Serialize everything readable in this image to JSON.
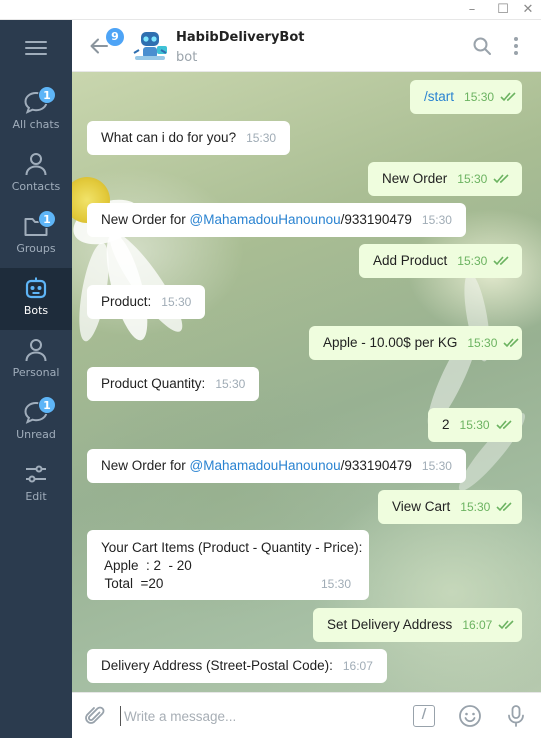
{
  "window": {
    "minimize": "–",
    "maximize": "☐",
    "close": "✕"
  },
  "sidebar": {
    "items": [
      {
        "label": "All chats",
        "badge": "1",
        "icon": "chat-bubble-icon"
      },
      {
        "label": "Contacts",
        "badge": "",
        "icon": "person-icon"
      },
      {
        "label": "Groups",
        "badge": "1",
        "icon": "folder-icon"
      },
      {
        "label": "Bots",
        "badge": "",
        "icon": "bot-icon",
        "active": true
      },
      {
        "label": "Personal",
        "badge": "",
        "icon": "person-icon"
      },
      {
        "label": "Unread",
        "badge": "1",
        "icon": "chat-bubble-icon"
      },
      {
        "label": "Edit",
        "badge": "",
        "icon": "sliders-icon"
      }
    ]
  },
  "header": {
    "back_badge": "9",
    "title": "HabibDeliveryBot",
    "subtitle": "bot"
  },
  "messages": [
    {
      "dir": "out",
      "text": "/start",
      "time": "15:30",
      "is_command": true
    },
    {
      "dir": "in",
      "text": "What can i do for you?",
      "time": "15:30"
    },
    {
      "dir": "out",
      "text": "New Order",
      "time": "15:30"
    },
    {
      "dir": "in",
      "prefix": "New Order for ",
      "mention": "@MahamadouHanounou",
      "suffix": "/933190479",
      "time": "15:30"
    },
    {
      "dir": "out",
      "text": "Add Product",
      "time": "15:30"
    },
    {
      "dir": "in",
      "text": "Product:",
      "time": "15:30"
    },
    {
      "dir": "out",
      "text": "Apple - 10.00$ per KG",
      "time": "15:30"
    },
    {
      "dir": "in",
      "text": "Product Quantity:",
      "time": "15:30"
    },
    {
      "dir": "out",
      "text": "2",
      "time": "15:30"
    },
    {
      "dir": "in",
      "prefix": "New Order for ",
      "mention": "@MahamadouHanounou",
      "suffix": "/933190479",
      "time": "15:30"
    },
    {
      "dir": "out",
      "text": "View Cart",
      "time": "15:30"
    },
    {
      "dir": "in",
      "lines": [
        "Your Cart Items (Product - Quantity - Price):",
        " Apple  : 2  - 20",
        " Total  =20"
      ],
      "time": "15:30"
    },
    {
      "dir": "out",
      "text": "Set Delivery Address",
      "time": "16:07"
    },
    {
      "dir": "in",
      "text": "Delivery Address (Street-Postal Code):",
      "time": "16:07"
    }
  ],
  "composer": {
    "placeholder": "Write a message...",
    "value": "",
    "command_label": "/"
  },
  "colors": {
    "sidebar_bg": "#2b3b4e",
    "sidebar_active": "#1e2c3b",
    "badge": "#5eb5f7",
    "outgoing_bubble": "#effdde",
    "incoming_bubble": "#ffffff",
    "mention": "#2a83d1",
    "read_check": "#6cb361"
  }
}
